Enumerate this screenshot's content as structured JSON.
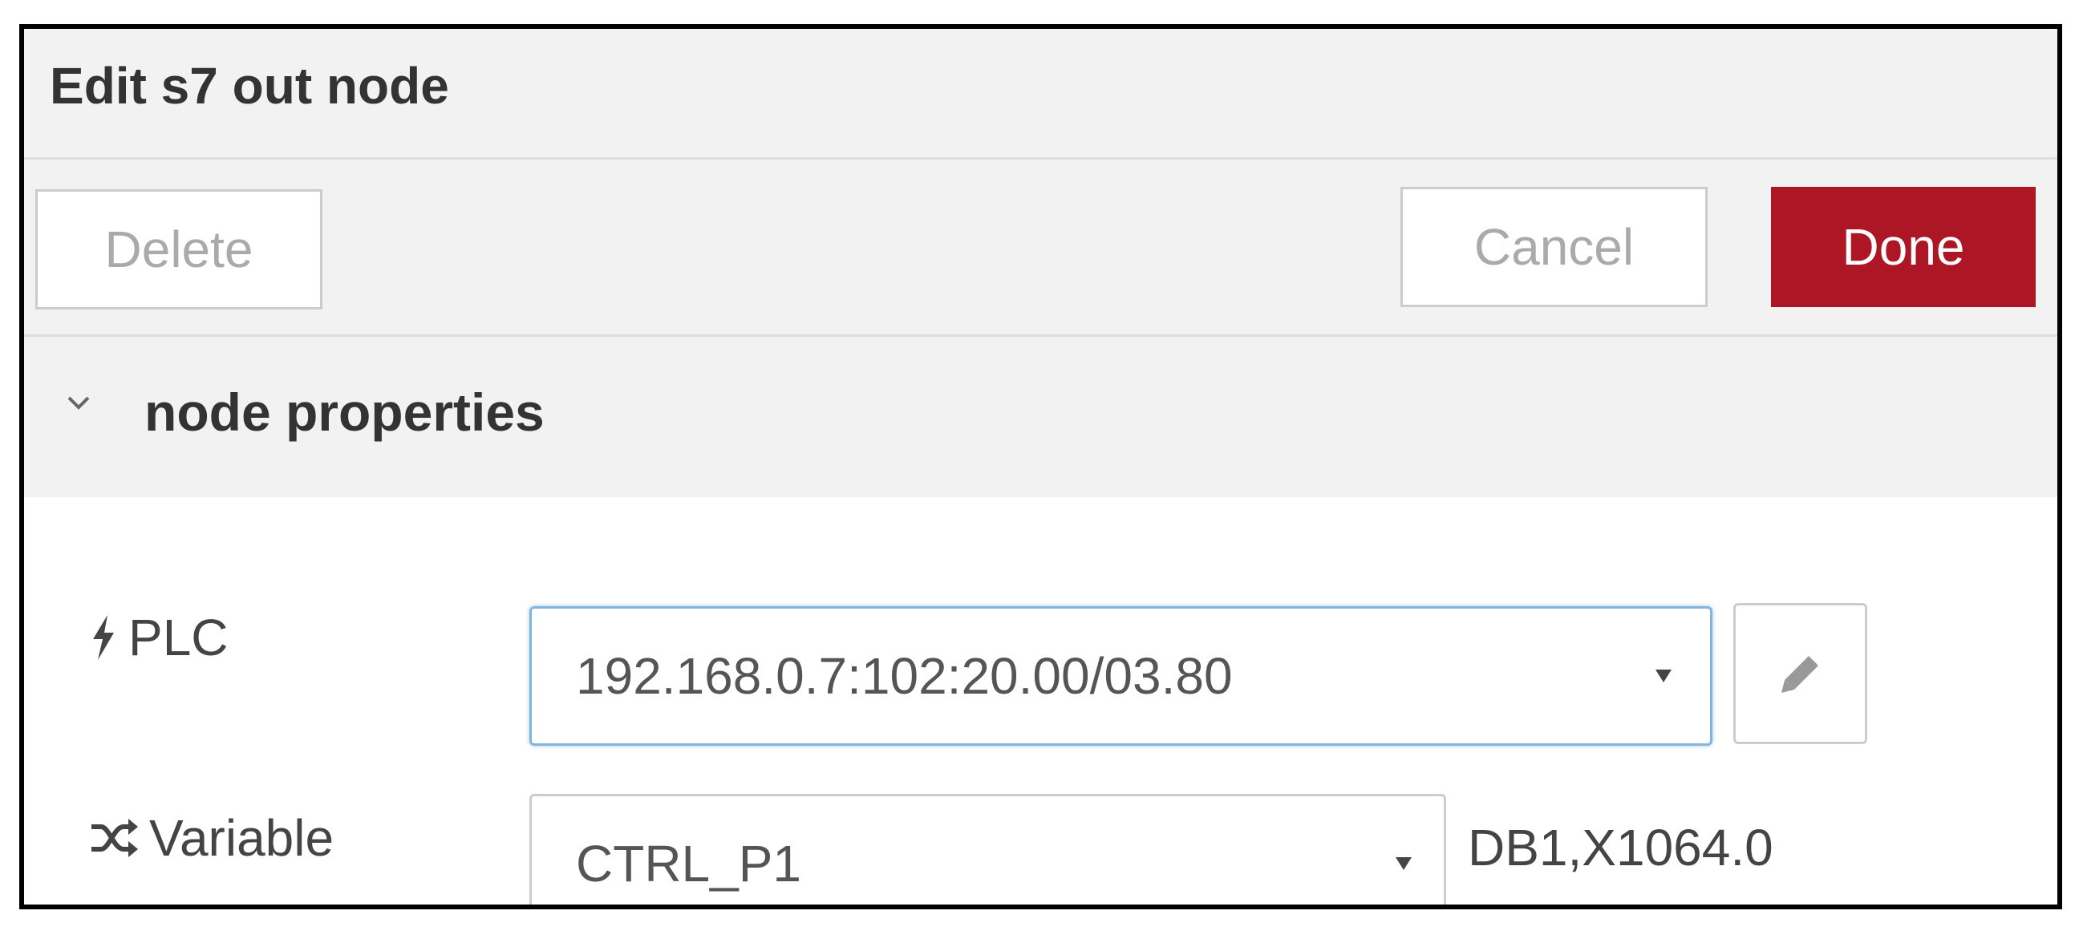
{
  "dialog": {
    "title": "Edit s7 out node"
  },
  "toolbar": {
    "delete_label": "Delete",
    "cancel_label": "Cancel",
    "done_label": "Done",
    "done_color": "#ad1625"
  },
  "section": {
    "title": "node properties",
    "expanded": true,
    "icon": "chevron-down-icon"
  },
  "form": {
    "plc": {
      "label": "PLC",
      "icon": "bolt-icon",
      "selected": "192.168.0.7:102:20.00/03.80",
      "edit_icon": "pencil-icon"
    },
    "variable": {
      "label": "Variable",
      "icon": "shuffle-icon",
      "selected": "CTRL_P1",
      "address": "DB1,X1064.0"
    }
  }
}
